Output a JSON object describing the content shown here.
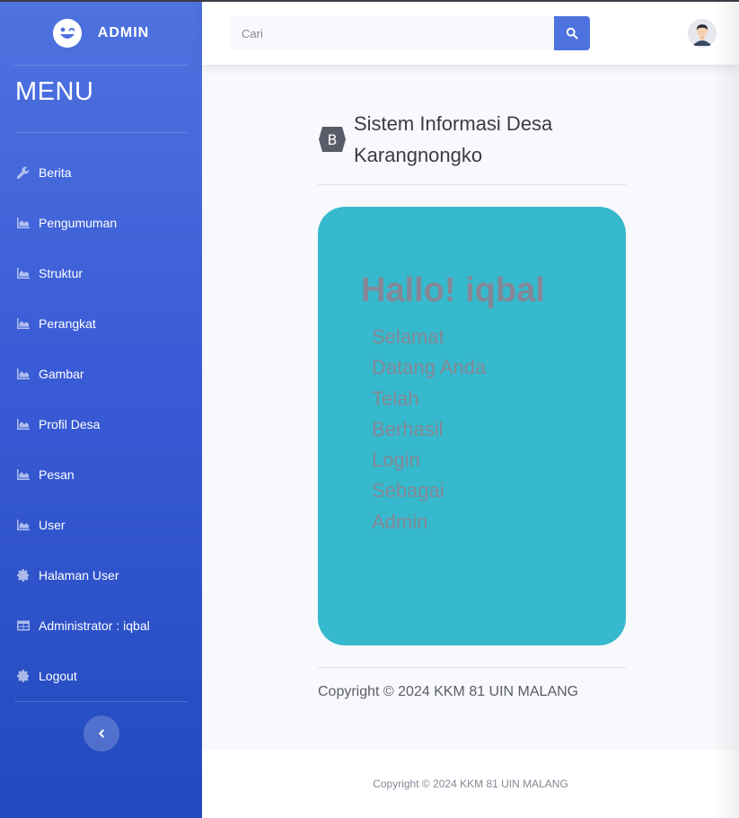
{
  "sidebar": {
    "brand": "ADMIN",
    "menu_title": "MENU",
    "items": [
      {
        "label": "Berita",
        "icon": "wrench-icon"
      },
      {
        "label": "Pengumuman",
        "icon": "area-chart-icon"
      },
      {
        "label": "Struktur",
        "icon": "area-chart-icon"
      },
      {
        "label": "Perangkat",
        "icon": "area-chart-icon"
      },
      {
        "label": "Gambar",
        "icon": "area-chart-icon"
      },
      {
        "label": "Profil Desa",
        "icon": "area-chart-icon"
      },
      {
        "label": "Pesan",
        "icon": "area-chart-icon"
      },
      {
        "label": "User",
        "icon": "area-chart-icon"
      },
      {
        "label": "Halaman User",
        "icon": "gear-icon"
      },
      {
        "label": "Administrator : iqbal",
        "icon": "table-icon"
      },
      {
        "label": "Logout",
        "icon": "gear-icon"
      }
    ]
  },
  "topbar": {
    "search_placeholder": "Cari"
  },
  "main": {
    "title_line1": "Sistem Informasi Desa",
    "title_line2": "Karangnongko",
    "greeting": "Hallo! iqbal",
    "message_words": [
      "Selamat",
      "Datang Anda",
      "Telah",
      "Berhasil",
      "Login",
      "Sebagai",
      "Admin"
    ],
    "copyright": "Copyright © 2024 KKM 81 UIN MALANG"
  },
  "footer": {
    "copyright": "Copyright © 2024 KKM 81 UIN MALANG"
  },
  "colors": {
    "primary": "#4e73df",
    "card": "#36b9cc",
    "muted_text": "#858796"
  }
}
